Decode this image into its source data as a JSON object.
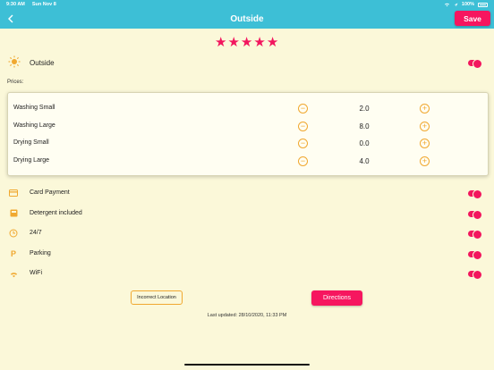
{
  "status": {
    "time": "9:30 AM",
    "date": "Sun Nov 8",
    "battery": "100%"
  },
  "nav": {
    "title": "Outside",
    "save_label": "Save",
    "back_icon": "chevron-left-icon"
  },
  "rating": {
    "stars": 5,
    "max": 5
  },
  "header_row": {
    "label": "Outside",
    "icon": "sun-icon",
    "enabled": true
  },
  "prices": {
    "label": "Prices:",
    "items": [
      {
        "name": "Washing Small",
        "value": "2.0"
      },
      {
        "name": "Washing Large",
        "value": "8.0"
      },
      {
        "name": "Drying Small",
        "value": "0.0"
      },
      {
        "name": "Drying Large",
        "value": "4.0"
      }
    ]
  },
  "features": [
    {
      "label": "Card Payment",
      "icon": "credit-card-icon",
      "enabled": true
    },
    {
      "label": "Detergent included",
      "icon": "detergent-icon",
      "enabled": true
    },
    {
      "label": "24/7",
      "icon": "clock-icon",
      "enabled": true
    },
    {
      "label": "Parking",
      "icon": "parking-icon",
      "enabled": true
    },
    {
      "label": "WiFi",
      "icon": "wifi-icon",
      "enabled": true
    }
  ],
  "actions": {
    "incorrect_location": "Incorrect Location",
    "directions": "Directions"
  },
  "last_updated": "Last updated: 28/10/2020, 11:33 PM",
  "colors": {
    "accent": "#f6165f",
    "header": "#3dbfd6",
    "background": "#fbf8d9",
    "icon": "#f0a830"
  }
}
